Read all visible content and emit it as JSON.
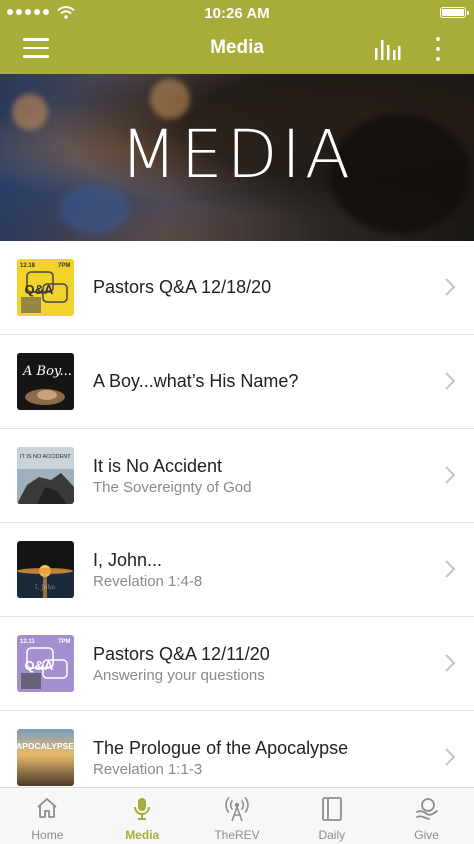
{
  "status_bar": {
    "time": "10:26 AM"
  },
  "header": {
    "title": "Media"
  },
  "banner": {
    "title": "MEDIA"
  },
  "colors": {
    "accent": "#a8ad3a",
    "text": "#222222",
    "subtext": "#8a8a8a",
    "tab_inactive": "#8e8e8e"
  },
  "media_items": [
    {
      "title": "Pastors Q&A 12/18/20",
      "subtitle": "",
      "thumb": {
        "date": "12.18",
        "time": "7PM",
        "mark": "Q&A"
      }
    },
    {
      "title": "A Boy...what’s His Name?",
      "subtitle": "",
      "thumb": {
        "script": "A Boy..."
      }
    },
    {
      "title": "It is No Accident",
      "subtitle": "The Sovereignty of God",
      "thumb": {
        "caption": "IT IS NO ACCIDENT"
      }
    },
    {
      "title": "I, John...",
      "subtitle": "Revelation 1:4-8",
      "thumb": {
        "script": "I, John"
      }
    },
    {
      "title": "Pastors Q&A 12/11/20",
      "subtitle": "Answering your questions",
      "thumb": {
        "date": "12.11",
        "time": "7PM",
        "mark": "Q&A"
      }
    },
    {
      "title": "The Prologue of the Apocalypse",
      "subtitle": "Revelation 1:1-3",
      "thumb": {
        "caption": "APOCALYPSE"
      }
    }
  ],
  "tabs": [
    {
      "label": "Home",
      "icon": "home-icon",
      "active": false
    },
    {
      "label": "Media",
      "icon": "microphone-icon",
      "active": true
    },
    {
      "label": "TheREV",
      "icon": "broadcast-icon",
      "active": false
    },
    {
      "label": "Daily",
      "icon": "book-icon",
      "active": false
    },
    {
      "label": "Give",
      "icon": "give-icon",
      "active": false
    }
  ]
}
